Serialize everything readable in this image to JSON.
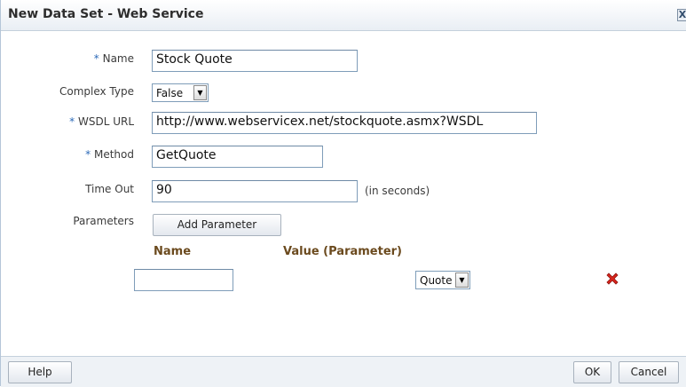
{
  "dialog": {
    "title": "New Data Set - Web Service",
    "close_label": "X"
  },
  "form": {
    "name": {
      "required_marker": "*",
      "label": "Name",
      "value": "Stock Quote"
    },
    "complex_type": {
      "label": "Complex Type",
      "selected": "False"
    },
    "wsdl_url": {
      "required_marker": "*",
      "label": "WSDL URL",
      "value": "http://www.webservicex.net/stockquote.asmx?WSDL"
    },
    "method": {
      "required_marker": "*",
      "label": "Method",
      "value": "GetQuote"
    },
    "time_out": {
      "label": "Time Out",
      "value": "90",
      "hint": "(in seconds)"
    },
    "parameters": {
      "label": "Parameters",
      "add_button": "Add Parameter",
      "columns": [
        "Name",
        "Value (Parameter)"
      ],
      "rows": [
        {
          "name": "",
          "value": "Quote"
        }
      ]
    }
  },
  "footer": {
    "help": "Help",
    "ok": "OK",
    "cancel": "Cancel"
  },
  "icons": {
    "close": "close-icon",
    "remove": "remove-parameter-icon",
    "dropdown": "chevron-down-icon"
  },
  "colors": {
    "required_marker": "#2c6ab8",
    "column_header": "#6b4a1e",
    "remove_icon": "#d9241b"
  }
}
